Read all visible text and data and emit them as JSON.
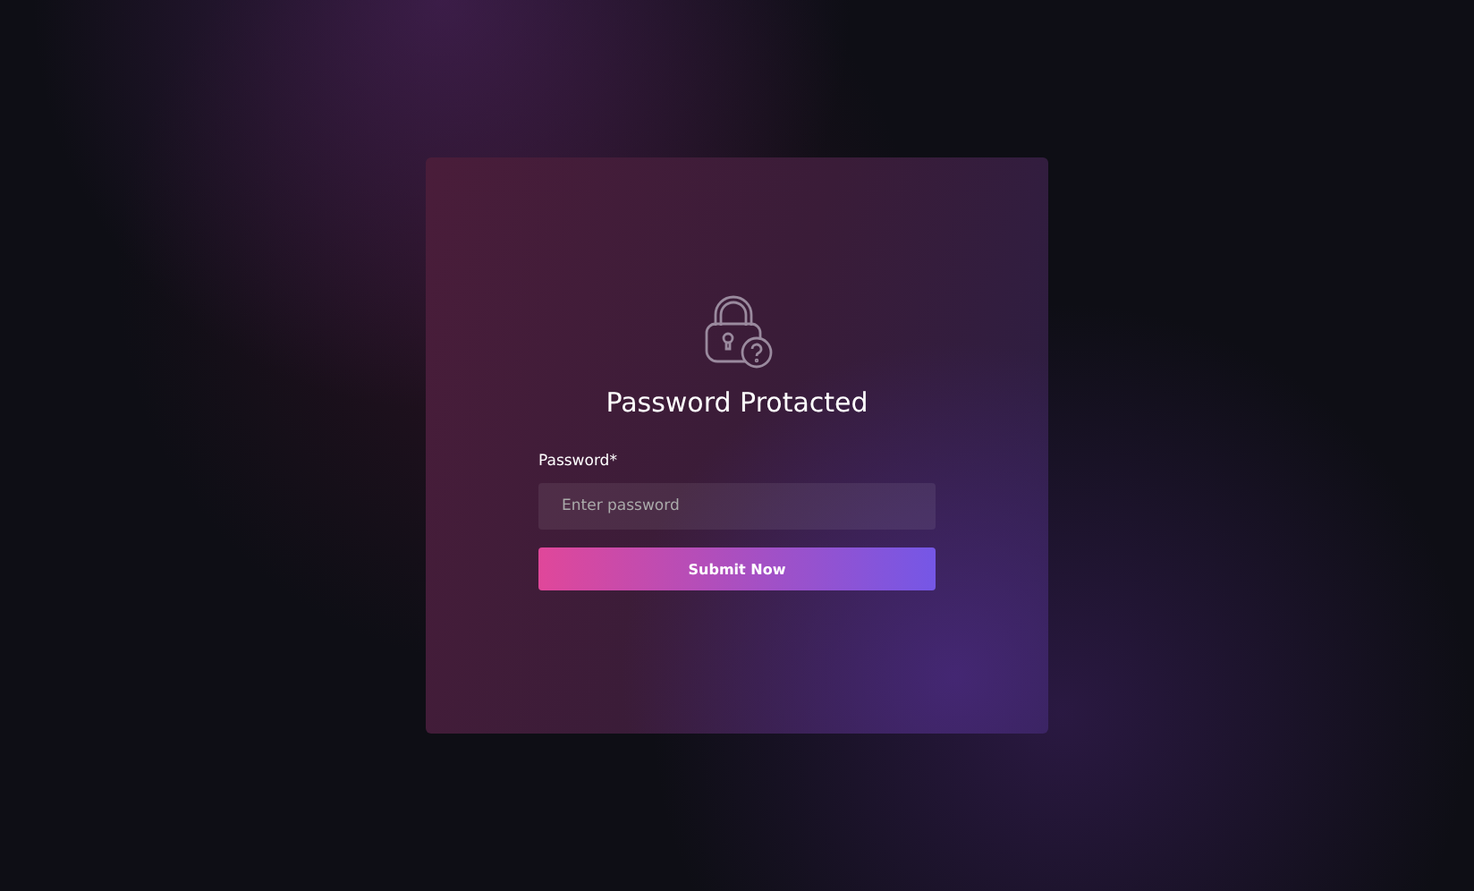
{
  "card": {
    "title": "Password Protacted",
    "field": {
      "label": "Password*",
      "placeholder": "Enter password"
    },
    "button": "Submit Now"
  }
}
